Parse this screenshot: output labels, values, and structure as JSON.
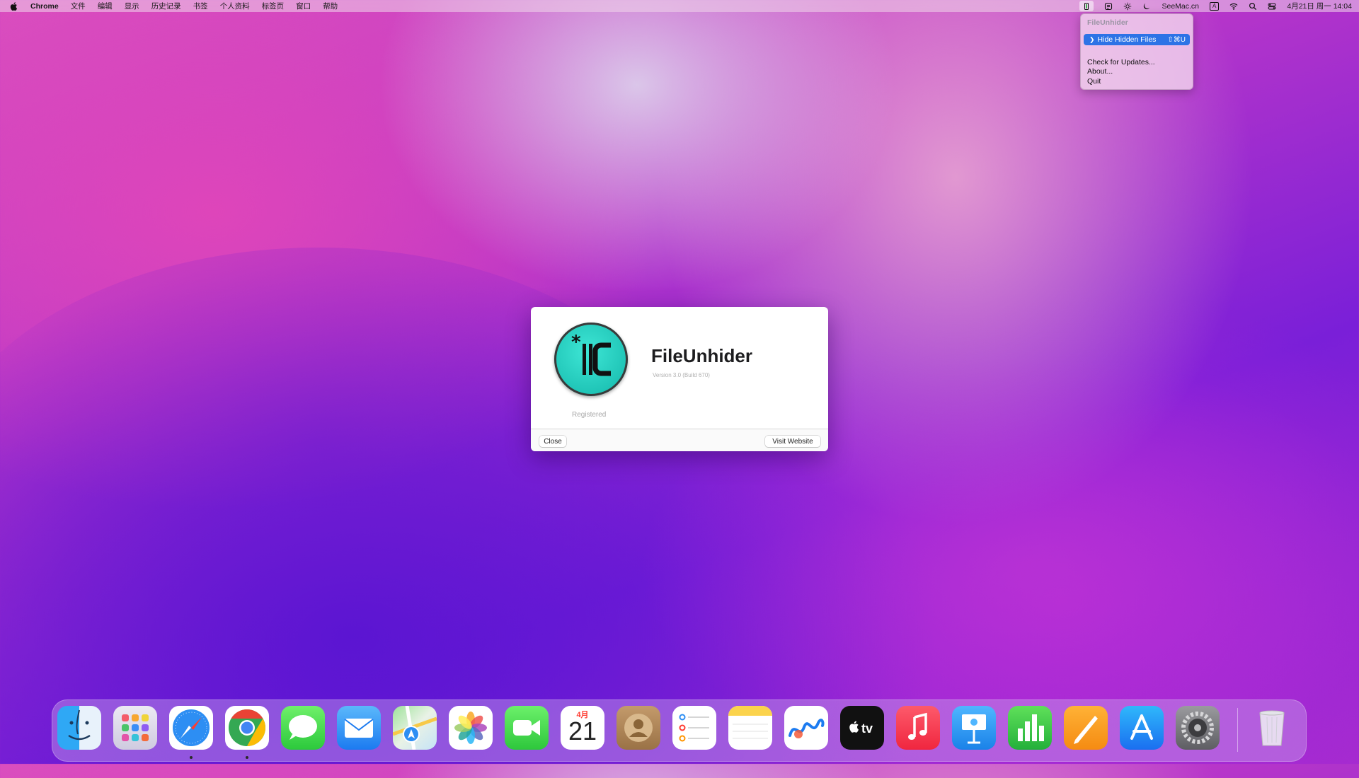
{
  "menubar": {
    "app_name": "Chrome",
    "menus": [
      "文件",
      "编辑",
      "显示",
      "历史记录",
      "书签",
      "个人资料",
      "标签页",
      "窗口",
      "帮助"
    ],
    "status_text": "SeeMac.cn",
    "input_method": "A",
    "datetime": "4月21日 周一  14:04"
  },
  "dropdown": {
    "header": "FileUnhider",
    "selected_item": "Hide Hidden Files",
    "selected_shortcut": "⇧⌘U",
    "items": [
      "Check for Updates...",
      "About...",
      "Quit"
    ]
  },
  "dialog": {
    "app_name": "FileUnhider",
    "version": "Version 3.0 (Build 670)",
    "status": "Registered",
    "close_label": "Close",
    "visit_label": "Visit Website"
  },
  "dock": {
    "calendar_month": "4月",
    "calendar_day": "21",
    "apps": [
      "finder-icon",
      "launchpad-icon",
      "safari-icon",
      "chrome-icon",
      "messages-icon",
      "mail-icon",
      "maps-icon",
      "photos-icon",
      "facetime-icon",
      "calendar-icon",
      "contacts-icon",
      "reminders-icon",
      "notes-icon",
      "freeform-icon",
      "apple-tv-icon",
      "music-icon",
      "keynote-icon",
      "numbers-icon",
      "pages-icon",
      "app-store-icon",
      "system-settings-icon",
      "trash-icon"
    ],
    "running": [
      "safari-icon",
      "chrome-icon"
    ]
  },
  "colors": {
    "selection_blue": "#2d73e6",
    "logo_teal": "#1fc4b6"
  }
}
